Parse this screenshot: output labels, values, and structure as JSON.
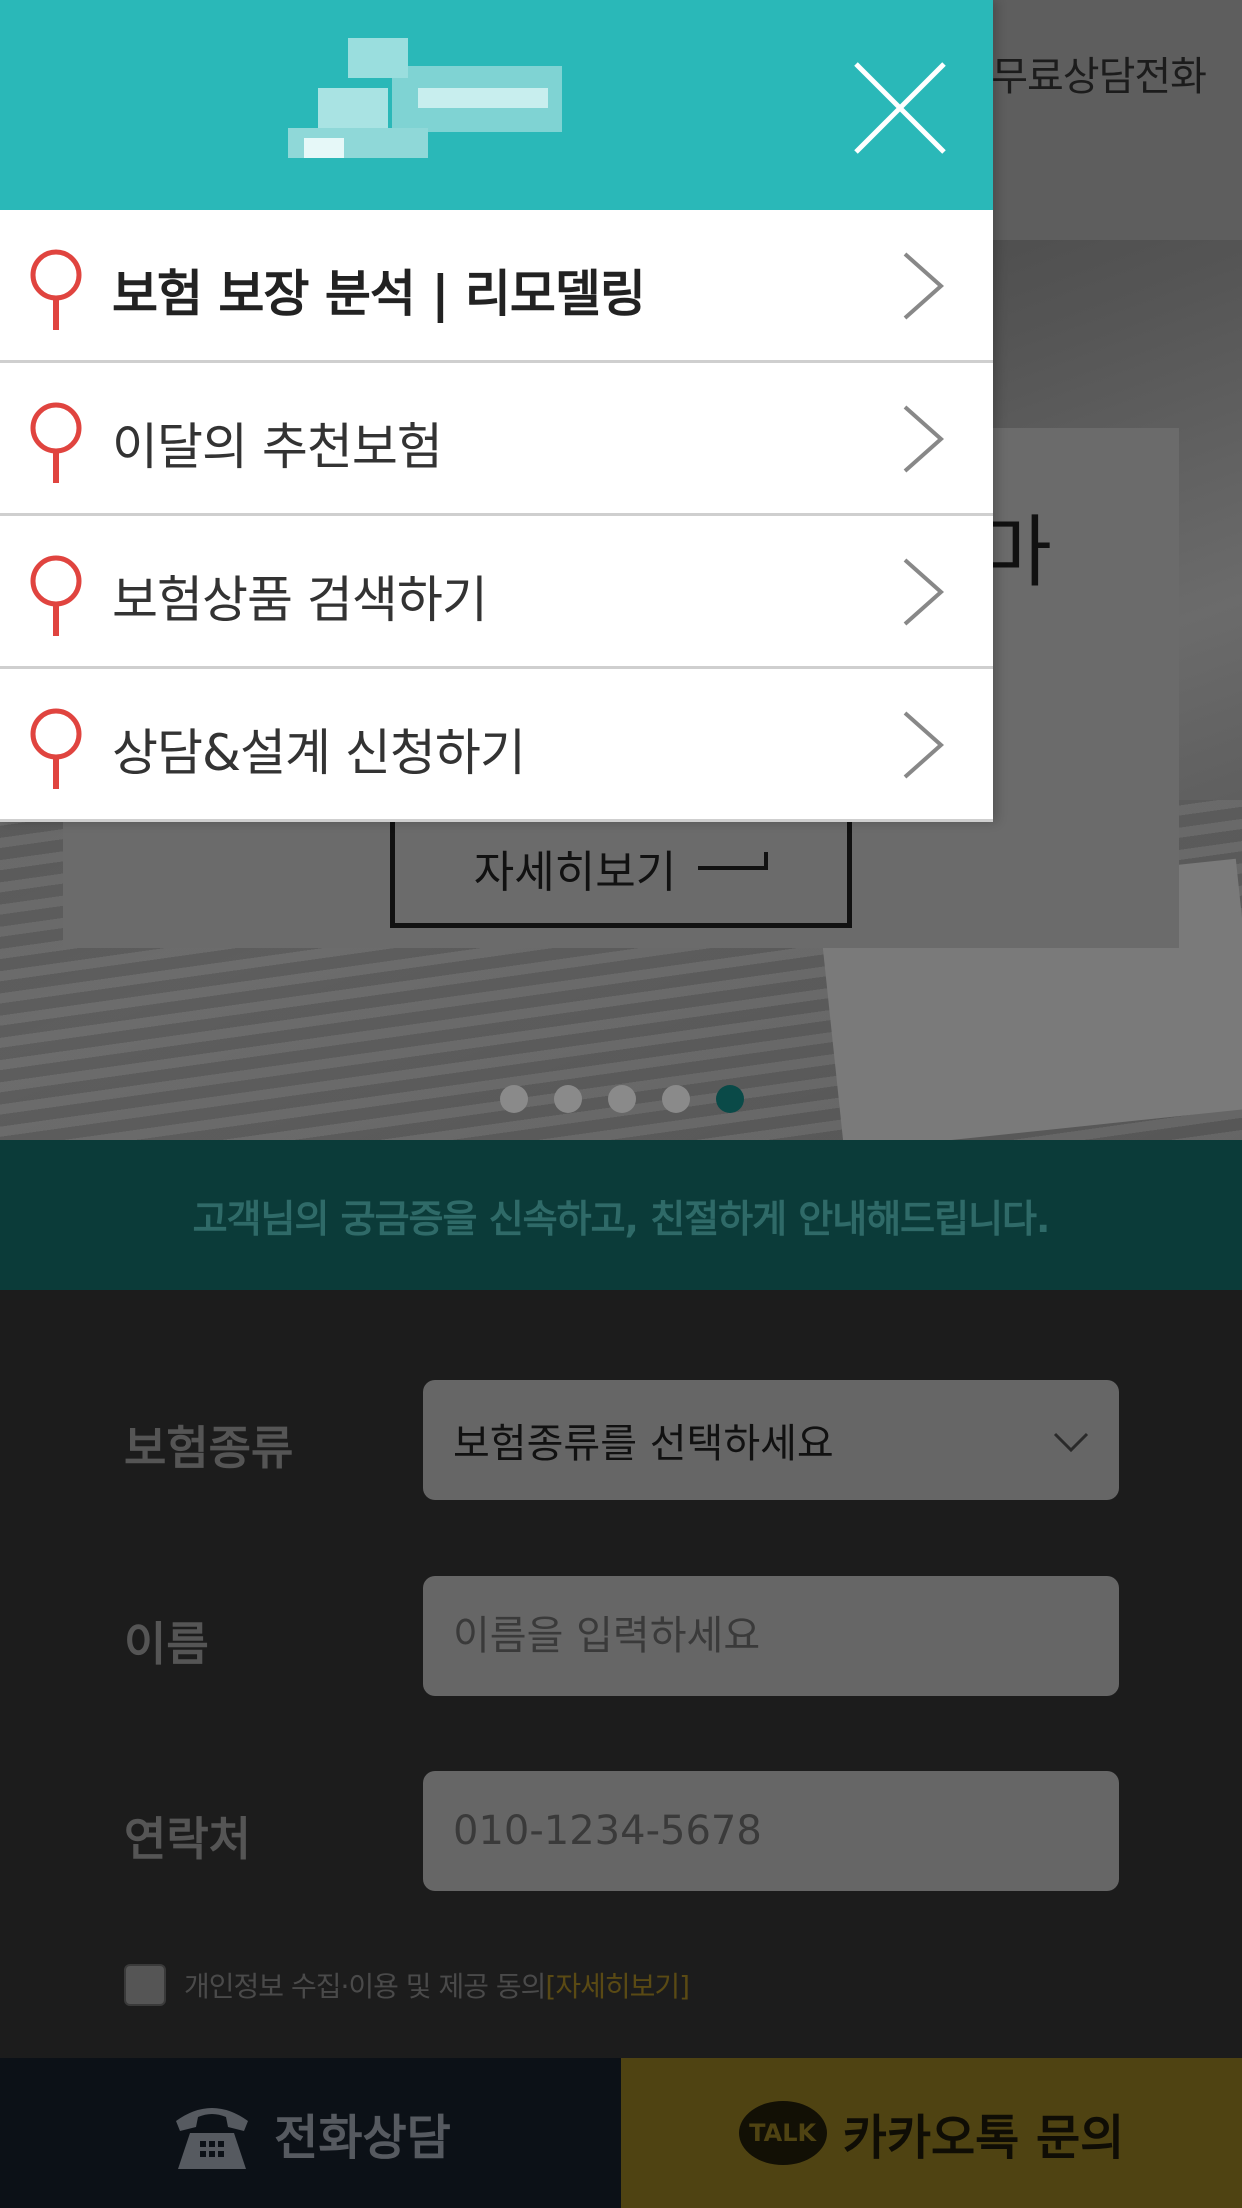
{
  "header": {
    "free_call_label": "무료상담전화"
  },
  "hero": {
    "heading_partial": "마",
    "detail_button_label": "자세히보기",
    "slides_total": 5,
    "active_slide": 5
  },
  "notice": {
    "text": "고객님의 궁금증을 신속하고, 친절하게 안내해드립니다."
  },
  "form": {
    "insurance_type": {
      "label": "보험종류",
      "selected": "보험종류를 선택하세요"
    },
    "name": {
      "label": "이름",
      "placeholder": "이름을 입력하세요"
    },
    "phone": {
      "label": "연락처",
      "placeholder": "010-1234-5678"
    },
    "consent": {
      "text": "개인정보 수집·이용 및 제공 동의",
      "link": "[자세히보기]"
    }
  },
  "bottom_bar": {
    "phone_label": "전화상담",
    "kakao_badge": "TALK",
    "kakao_label": "카카오톡 문의"
  },
  "drawer": {
    "menu": [
      {
        "label": "보험 보장 분석 | 리모델링",
        "bold": true
      },
      {
        "label": "이달의 추천보험",
        "bold": false
      },
      {
        "label": "보험상품 검색하기",
        "bold": false
      },
      {
        "label": "상담&설계 신청하기",
        "bold": false
      }
    ]
  },
  "colors": {
    "drawer_header": "#2ab8b8",
    "pin_icon": "#e0443f",
    "kakao_yellow": "#4f4312",
    "notice_bar": "#0b3b39"
  }
}
